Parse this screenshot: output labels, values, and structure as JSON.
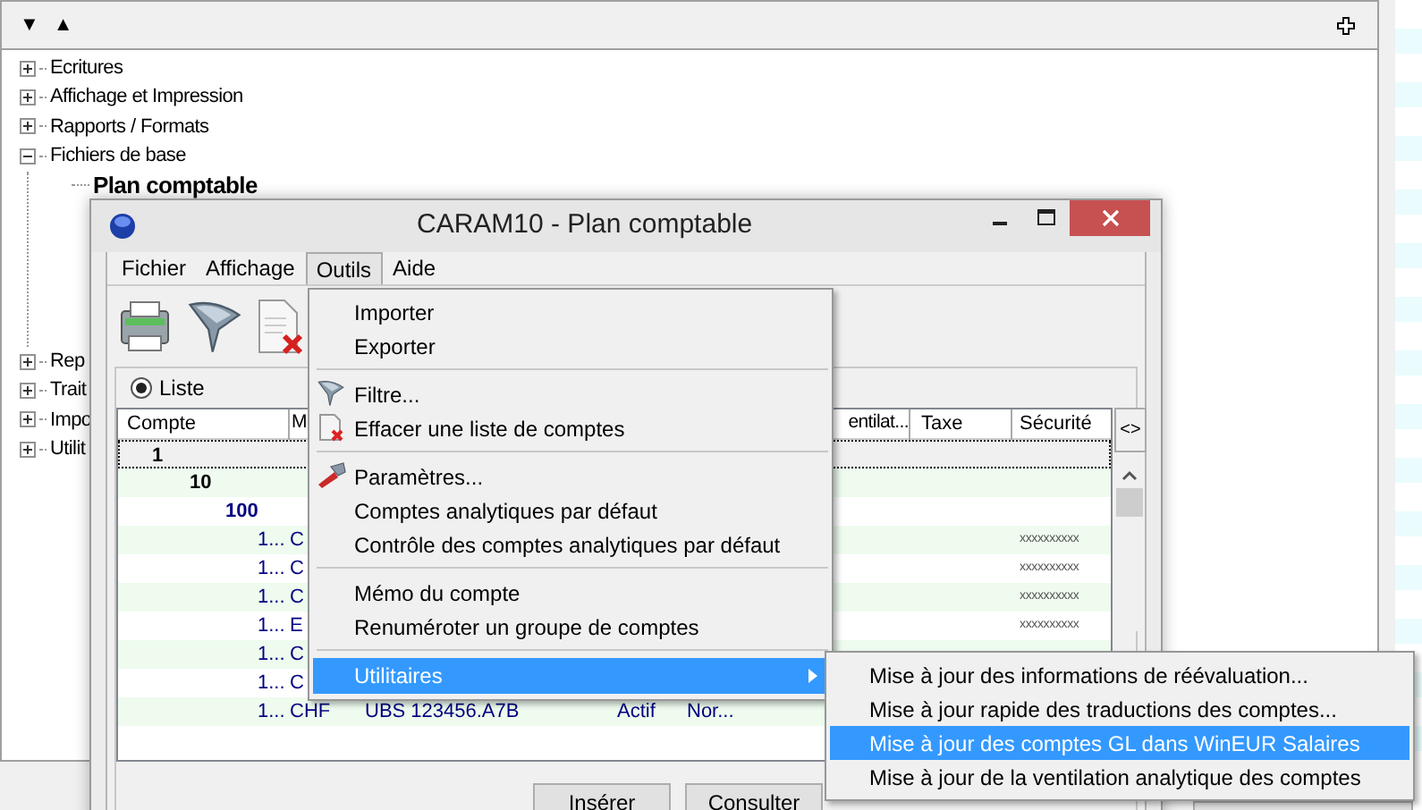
{
  "top_toolbar": {
    "buttons": [
      "▼",
      "▲"
    ]
  },
  "tree": [
    {
      "label": "Ecritures",
      "expanded": false
    },
    {
      "label": "Affichage et Impression",
      "expanded": false
    },
    {
      "label": "Rapports / Formats",
      "expanded": false
    },
    {
      "label": "Fichiers de base",
      "expanded": true,
      "children": [
        {
          "label": "Plan comptable",
          "selected": true
        }
      ]
    },
    {
      "label": "Rep",
      "expanded": false
    },
    {
      "label": "Trait",
      "expanded": false
    },
    {
      "label": "Impo",
      "expanded": false
    },
    {
      "label": "Utilit",
      "expanded": false
    }
  ],
  "dialog": {
    "title": "CARAM10 - Plan comptable",
    "menu": [
      {
        "label": "Fichier",
        "selected": false
      },
      {
        "label": "Affichage",
        "selected": false
      },
      {
        "label": "Outils",
        "selected": true
      },
      {
        "label": "Aide",
        "selected": false
      }
    ],
    "view_option": {
      "label": "Liste",
      "selected": true
    },
    "table": {
      "columns": [
        "Compte",
        "M",
        "entilat...",
        "Taxe",
        "Sécurité"
      ],
      "rows": [
        {
          "kind": "class",
          "account": "1"
        },
        {
          "kind": "group",
          "account": "10"
        },
        {
          "kind": "subgroup",
          "account": "100"
        },
        {
          "kind": "account",
          "account": "1...",
          "currency": "C",
          "security": "xxxxxxxxxx"
        },
        {
          "kind": "account",
          "account": "1...",
          "currency": "C",
          "security": "xxxxxxxxxx"
        },
        {
          "kind": "account",
          "account": "1...",
          "currency": "C",
          "security": "xxxxxxxxxx"
        },
        {
          "kind": "account",
          "account": "1...",
          "currency": "E",
          "security": "xxxxxxxxxx"
        },
        {
          "kind": "account",
          "account": "1...",
          "currency": "C"
        },
        {
          "kind": "account",
          "account": "1...",
          "currency": "C"
        },
        {
          "kind": "account",
          "account": "1...",
          "currency": "CHF",
          "description": "UBS 123456.A7B",
          "status": "Actif",
          "column_5": "Nor..."
        }
      ]
    },
    "scroll_button": "<>",
    "buttons": [
      "Insérer",
      "Consulter"
    ]
  },
  "tools_menu": {
    "items": [
      {
        "kind": "item",
        "label": "Importer"
      },
      {
        "kind": "item",
        "label": "Exporter"
      },
      {
        "kind": "separator"
      },
      {
        "kind": "item",
        "label": "Filtre..."
      },
      {
        "kind": "item",
        "label": "Effacer une liste de comptes"
      },
      {
        "kind": "separator"
      },
      {
        "kind": "item",
        "label": "Paramètres..."
      },
      {
        "kind": "item",
        "label": "Comptes analytiques par défaut"
      },
      {
        "kind": "item",
        "label": "Contrôle des comptes analytiques par défaut"
      },
      {
        "kind": "separator"
      },
      {
        "kind": "item",
        "label": "Mémo du compte"
      },
      {
        "kind": "item",
        "label": "Renuméroter un groupe de comptes"
      },
      {
        "kind": "separator"
      },
      {
        "kind": "submenu",
        "label": "Utilitaires",
        "selected": true
      }
    ]
  },
  "utilities_submenu": {
    "items": [
      {
        "label": "Mise à jour des informations de réévaluation...",
        "selected": false
      },
      {
        "label": "Mise à jour rapide des traductions des comptes...",
        "selected": false
      },
      {
        "label": "Mise à jour des comptes GL dans WinEUR Salaires",
        "selected": true
      },
      {
        "label": "Mise à jour de la ventilation analytique des comptes",
        "selected": false
      }
    ]
  }
}
